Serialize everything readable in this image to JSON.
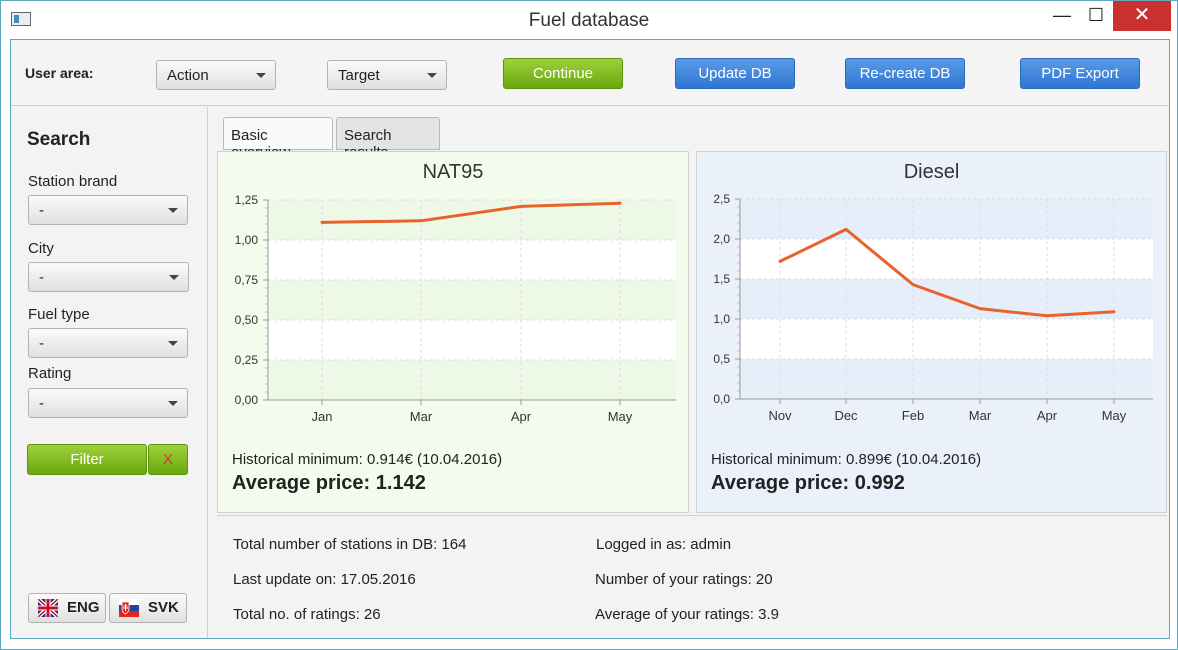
{
  "window": {
    "title": "Fuel database",
    "minimize": "—",
    "maximize": "☐",
    "close": "✕"
  },
  "toolbar": {
    "user_area_label": "User area:",
    "action_value": "Action",
    "target_value": "Target",
    "continue_label": "Continue",
    "update_label": "Update DB",
    "recreate_label": "Re-create DB",
    "pdf_label": "PDF Export"
  },
  "sidebar": {
    "title": "Search",
    "fields": [
      {
        "label": "Station brand",
        "value": "-"
      },
      {
        "label": "City",
        "value": "-"
      },
      {
        "label": "Fuel type",
        "value": "-"
      },
      {
        "label": "Rating",
        "value": "-"
      }
    ],
    "filter_label": "Filter",
    "clear_label": "X",
    "lang_eng": "ENG",
    "lang_svk": "SVK"
  },
  "tabs": [
    {
      "label": "Basic overview"
    },
    {
      "label": "Search results"
    }
  ],
  "panels": [
    {
      "title": "NAT95",
      "historical": "Historical minimum: 0.914€ (10.04.2016)",
      "average": "Average price: 1.142"
    },
    {
      "title": "Diesel",
      "historical": "Historical minimum: 0.899€ (10.04.2016)",
      "average": "Average price: 0.992"
    }
  ],
  "chart_data": [
    {
      "type": "line",
      "title": "NAT95",
      "categories": [
        "Jan",
        "Mar",
        "Apr",
        "May"
      ],
      "values": [
        1.11,
        1.12,
        1.21,
        1.23
      ],
      "ylim": [
        0,
        1.25
      ],
      "yticks": [
        "0,00",
        "0,25",
        "0,50",
        "0,75",
        "1,00",
        "1,25"
      ],
      "color": "#e8622c",
      "grid": true
    },
    {
      "type": "line",
      "title": "Diesel",
      "categories": [
        "Nov",
        "Dec",
        "Feb",
        "Mar",
        "Apr",
        "May"
      ],
      "values": [
        1.72,
        2.12,
        1.43,
        1.13,
        1.04,
        1.09
      ],
      "ylim": [
        0,
        2.5
      ],
      "yticks": [
        "0,0",
        "0,5",
        "1,0",
        "1,5",
        "2,0",
        "2,5"
      ],
      "color": "#e8622c",
      "grid": true
    }
  ],
  "stats": {
    "total_stations": "Total number of stations in DB: 164",
    "last_update": "Last update on: 17.05.2016",
    "total_ratings": "Total no. of ratings: 26",
    "logged_in": "Logged in as: admin",
    "your_ratings": "Number of your ratings: 20",
    "your_average": "Average of your ratings: 3.9"
  }
}
